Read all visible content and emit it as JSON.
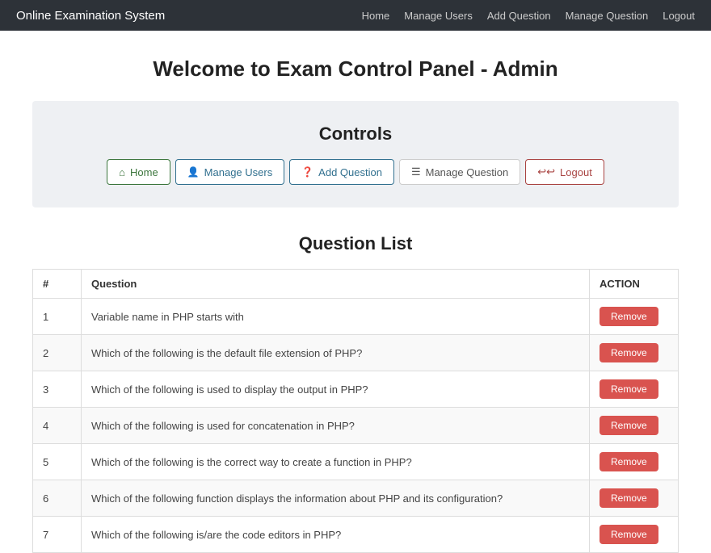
{
  "navbar": {
    "brand": "Online Examination System",
    "nav_items": [
      {
        "label": "Home",
        "href": "#"
      },
      {
        "label": "Manage Users",
        "href": "#"
      },
      {
        "label": "Add Question",
        "href": "#"
      },
      {
        "label": "Manage Question",
        "href": "#"
      },
      {
        "label": "Logout",
        "href": "#"
      }
    ]
  },
  "page": {
    "welcome_title": "Welcome to Exam Control Panel - Admin"
  },
  "controls": {
    "title": "Controls",
    "buttons": [
      {
        "label": "Home",
        "class": "btn-home",
        "icon": "home"
      },
      {
        "label": "Manage Users",
        "class": "btn-users",
        "icon": "users"
      },
      {
        "label": "Add Question",
        "class": "btn-add",
        "icon": "question"
      },
      {
        "label": "Manage Question",
        "class": "btn-manage",
        "icon": "list"
      },
      {
        "label": "Logout",
        "class": "btn-logout",
        "icon": "logout"
      }
    ]
  },
  "question_list": {
    "title": "Question List",
    "columns": [
      "#",
      "Question",
      "ACTION"
    ],
    "rows": [
      {
        "id": 1,
        "question": "Variable name in PHP starts with"
      },
      {
        "id": 2,
        "question": "Which of the following is the default file extension of PHP?"
      },
      {
        "id": 3,
        "question": "Which of the following is used to display the output in PHP?"
      },
      {
        "id": 4,
        "question": "Which of the following is used for concatenation in PHP?"
      },
      {
        "id": 5,
        "question": "Which of the following is the correct way to create a function in PHP?"
      },
      {
        "id": 6,
        "question": "Which of the following function displays the information about PHP and its configuration?"
      },
      {
        "id": 7,
        "question": "Which of the following is/are the code editors in PHP?"
      }
    ],
    "remove_label": "Remove"
  }
}
